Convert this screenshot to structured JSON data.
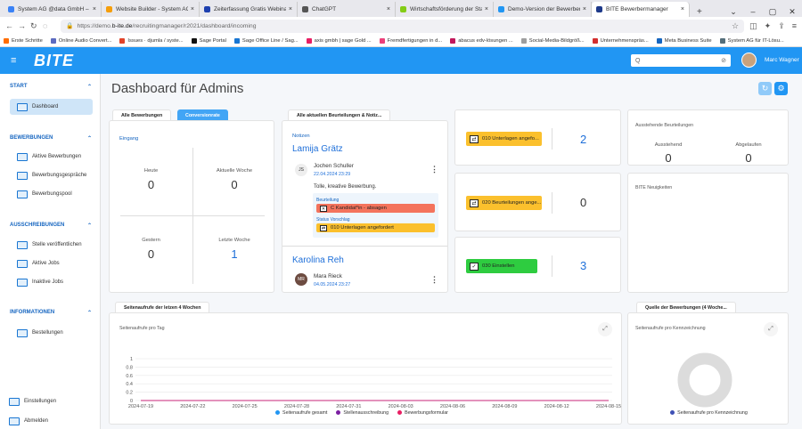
{
  "browser": {
    "tabs": [
      {
        "title": "System AG @data GmbH – B-ite",
        "color": "#3b82f6"
      },
      {
        "title": "Website Builder - System AG",
        "color": "#f59e0b"
      },
      {
        "title": "Zeiterfassung Gratis Webinar |",
        "color": "#1e40af"
      },
      {
        "title": "ChatGPT",
        "color": "#555555"
      },
      {
        "title": "Wirtschaftsförderung der Stadt",
        "color": "#84cc16"
      },
      {
        "title": "Demo-Version der Bewerberm",
        "color": "#2196f3"
      },
      {
        "title": "BITE Bewerbermanager",
        "color": "#1e3a8a"
      }
    ],
    "url_prefix": "https://demo.",
    "url_domain": "b-ite.de",
    "url_path": "/recruitingmanager/r2021/dashboard/incoming",
    "bookmarks": [
      "Erste Schritte",
      "Online Audio Convert...",
      "Issues · djumla / syste...",
      "Sage Portal",
      "Sage Office Line / Sag...",
      "axis gmbh | sage Gold ...",
      "Fremdfertigungen in d...",
      "abacus edv-lösungen ...",
      "Social-Media-Bildgröß...",
      "Unternehmenspräs...",
      "Meta Business Suite",
      "System AG für IT-Lösu..."
    ]
  },
  "app": {
    "logo": "BITE",
    "search_placeholder": "Q",
    "user_name": "Marc Wagner",
    "brand_color": "#2196f3"
  },
  "sidebar": {
    "start": "START",
    "dashboard": "Dashboard",
    "bewerbungen": "BEWERBUNGEN",
    "aktive_bewerbungen": "Aktive Bewerbungen",
    "gespraeche": "Bewerbungsgespräche",
    "pool": "Bewerbungspool",
    "ausschreibungen": "AUSSCHREIBUNGEN",
    "stelle": "Stelle veröffentlichen",
    "aktive_jobs": "Aktive Jobs",
    "inaktive_jobs": "Inaktive Jobs",
    "informationen": "INFORMATIONEN",
    "bestellungen": "Bestellungen",
    "einstellungen": "Einstellungen",
    "abmelden": "Abmelden"
  },
  "page": {
    "title": "Dashboard für Admins"
  },
  "bewerbungen_card": {
    "tab_all": "Alle Bewerbungen",
    "tab_conv": "Conversionrate",
    "section": "Eingang",
    "heute_label": "Heute",
    "heute": "0",
    "woche_label": "Aktuelle Woche",
    "woche": "0",
    "gestern_label": "Gestern",
    "gestern": "0",
    "letzte_label": "Letzte Woche",
    "letzte": "1"
  },
  "notizen_card": {
    "tab": "Alle aktuellen Beurteilungen & Notiz...",
    "section": "Notizen",
    "cand1": "Lamija Grätz",
    "author1": "Jochen Schuller",
    "initials1": "JS",
    "date1": "22.04.2024 23:29",
    "note1": "Tolle, kreative Bewerbung.",
    "beurteilung_label": "Beurteilung",
    "beurteilung_value": "C Kandidat*in - absagen",
    "status_label": "Status Vorschlag",
    "status_value": "010 Unterlagen angefordert",
    "cand2": "Karolina Reh",
    "author2": "Mara Rieck",
    "initials2": "MR",
    "date2": "04.05.2024 23:27"
  },
  "status_cards": [
    {
      "label": "010 Unterlagen angefo...",
      "count": "2",
      "color": "#fbc02d"
    },
    {
      "label": "020 Beurteilungen ange...",
      "count": "0",
      "color": "#fbc02d"
    },
    {
      "label": "030 Einstellen",
      "count": "3",
      "color": "#2ecc40"
    }
  ],
  "ausstehend_card": {
    "title": "Ausstehende Beurteilungen",
    "ausstehend_label": "Ausstehend",
    "ausstehend": "0",
    "abgelaufen_label": "Abgelaufen",
    "abgelaufen": "0"
  },
  "news_card": {
    "title": "BITE Neuigkeiten"
  },
  "chart_card": {
    "tab": "Seitenaufrufe der letzen 4 Wochen",
    "subtitle": "Seitenaufrufe pro Tag",
    "y_ticks": [
      "1",
      "0.8",
      "0.6",
      "0.4",
      "0.2",
      "0"
    ]
  },
  "chart_data": {
    "type": "line",
    "title": "Seitenaufrufe pro Tag",
    "x": [
      "2024-07-19",
      "2024-07-22",
      "2024-07-25",
      "2024-07-28",
      "2024-07-31",
      "2024-08-03",
      "2024-08-06",
      "2024-08-09",
      "2024-08-12",
      "2024-08-15"
    ],
    "ylim": [
      0,
      1
    ],
    "series": [
      {
        "name": "Seitenaufrufe gesamt",
        "color": "#2196f3",
        "values": [
          0,
          0,
          0,
          0,
          0,
          0,
          0,
          0,
          0,
          0
        ]
      },
      {
        "name": "Stellenausschreibung",
        "color": "#7b1fa2",
        "values": [
          0,
          0,
          0,
          0,
          0,
          0,
          0,
          0,
          0,
          0
        ]
      },
      {
        "name": "Bewerbungsformular",
        "color": "#e91e63",
        "values": [
          0,
          0,
          0,
          0,
          0,
          0,
          0,
          0,
          0,
          0
        ]
      }
    ]
  },
  "quelle_card": {
    "tab": "Quelle der Bewerbungen (4 Woche...",
    "subtitle": "Seitenaufrufe pro Kennzeichnung",
    "legend": "Seitenaufrufe pro Kennzeichnung",
    "legend_color": "#3f51b5"
  }
}
